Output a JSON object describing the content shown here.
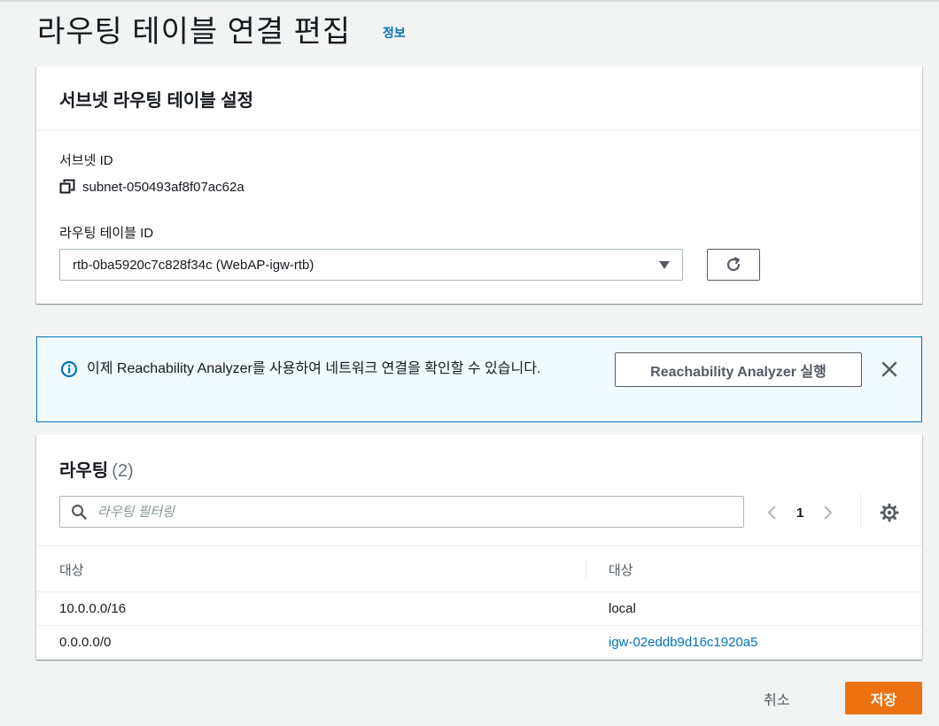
{
  "page": {
    "title": "라우팅 테이블 연결 편집",
    "info_link": "정보"
  },
  "settings": {
    "header": "서브넷 라우팅 테이블 설정",
    "subnet_label": "서브넷 ID",
    "subnet_id": "subnet-050493af8f07ac62a",
    "route_table_label": "라우팅 테이블 ID",
    "route_table_selected": "rtb-0ba5920c7c828f34c (WebAP-igw-rtb)"
  },
  "alert": {
    "text": "이제 Reachability Analyzer를 사용하여 네트워크 연결을 확인할 수 있습니다.",
    "button_label": "Reachability Analyzer 실행"
  },
  "routes": {
    "title": "라우팅",
    "count": "(2)",
    "filter_placeholder": "라우팅 필터링",
    "page": "1",
    "columns": [
      "대상",
      "대상"
    ],
    "rows": [
      {
        "destination": "10.0.0.0/16",
        "target": "local"
      },
      {
        "destination": "0.0.0.0/0",
        "target": "igw-02eddb9d16c1920a5"
      }
    ]
  },
  "footer": {
    "cancel_label": "취소",
    "save_label": "저장"
  },
  "colors": {
    "primary_button": "#ec7211",
    "link": "#0073bb",
    "info_border": "#0073bb",
    "info_background": "#f1faff"
  },
  "icons": {
    "copy": "copy-icon",
    "caret": "caret-down-icon",
    "refresh": "refresh-icon",
    "info": "info-icon",
    "close": "close-icon",
    "search": "search-icon",
    "prev": "chevron-left-icon",
    "next": "chevron-right-icon",
    "settings": "gear-icon"
  }
}
